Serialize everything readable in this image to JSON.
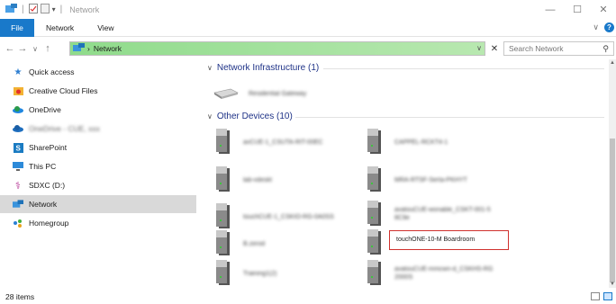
{
  "window": {
    "title": "Network",
    "controls": {
      "minimize": "—",
      "maximize": "☐",
      "close": "✕"
    }
  },
  "ribbon": {
    "tabs": [
      "File",
      "Network",
      "View"
    ],
    "help": "?"
  },
  "address": {
    "path_root": "Network",
    "separator": "›",
    "search_placeholder": "Search Network"
  },
  "sidebar": {
    "items": [
      {
        "label": "Quick access",
        "icon": "star-icon",
        "blurred": false
      },
      {
        "label": "Creative Cloud Files",
        "icon": "creative-cloud-icon",
        "blurred": false
      },
      {
        "label": "OneDrive",
        "icon": "onedrive-icon",
        "blurred": false
      },
      {
        "label": "OneDrive - CUE, xxx",
        "icon": "onedrive-icon",
        "blurred": true
      },
      {
        "label": "SharePoint",
        "icon": "sharepoint-icon",
        "blurred": false
      },
      {
        "label": "This PC",
        "icon": "this-pc-icon",
        "blurred": false
      },
      {
        "label": "SDXC (D:)",
        "icon": "sd-card-icon",
        "blurred": false
      },
      {
        "label": "Network",
        "icon": "network-icon",
        "blurred": false,
        "selected": true
      },
      {
        "label": "Homegroup",
        "icon": "homegroup-icon",
        "blurred": false
      }
    ]
  },
  "groups": {
    "infrastructure": {
      "label": "Network Infrastructure (1)",
      "items": [
        "Residential Gateway"
      ]
    },
    "other": {
      "label": "Other Devices (10)",
      "left": [
        "avCUE-1_CSUTA-RIT-00EC",
        "lab-vdeskt",
        "touchCUE-1_CSKIO-RG-0A0SS",
        "B.zerod",
        "Training1(2)"
      ],
      "right": [
        "CAPPEL-RCKT4-1",
        "MRA-RTSF-Serta-PKHYT",
        "avatouCUE-wonable_CSKT-001-5 8C9e",
        "touchONE-10-M Boardroom",
        "avatouCUE-mmcwn-d_CSKHS-RG 2000S"
      ],
      "highlighted": "touchONE-10-M Boardroom"
    }
  },
  "status": {
    "count": "28 items"
  },
  "colors": {
    "accent": "#1979ca",
    "address_green": "#8fdb8b",
    "highlight": "#d0312d",
    "selected_row": "#d9d9d9"
  }
}
